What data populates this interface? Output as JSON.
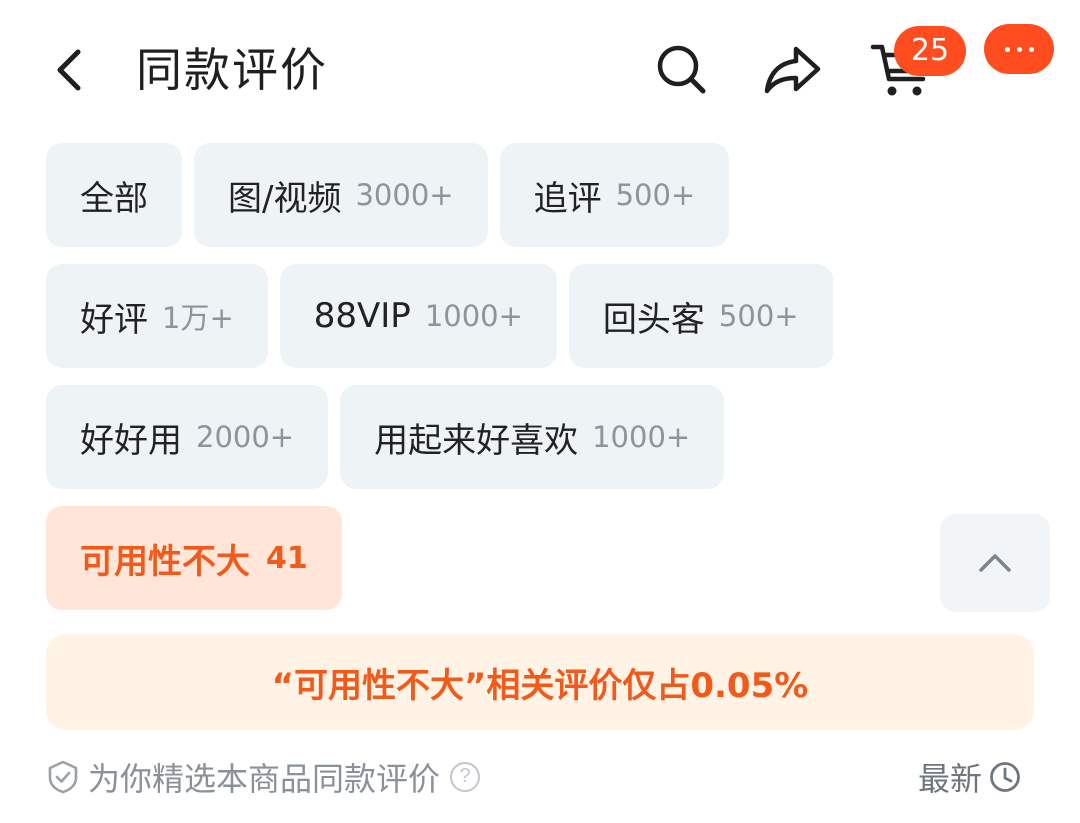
{
  "header": {
    "title": "同款评价",
    "cart_count": "25"
  },
  "filters": {
    "rows": [
      [
        {
          "label": "全部",
          "count": ""
        },
        {
          "label": "图/视频",
          "count": "3000+"
        },
        {
          "label": "追评",
          "count": "500+"
        }
      ],
      [
        {
          "label": "好评",
          "count": "1万+"
        },
        {
          "label": "88VIP",
          "count": "1000+"
        },
        {
          "label": "回头客",
          "count": "500+"
        }
      ],
      [
        {
          "label": "好好用",
          "count": "2000+"
        },
        {
          "label": "用起来好喜欢",
          "count": "1000+"
        }
      ]
    ],
    "active": {
      "label": "可用性不大",
      "count": "41"
    }
  },
  "notice": {
    "text": "“可用性不大”相关评价仅占0.05%"
  },
  "footer": {
    "selection_text": "为你精选本商品同款评价",
    "sort_label": "最新"
  },
  "colors": {
    "accent": "#f25a1b",
    "badge": "#ff4d1f",
    "chip_bg": "#eef3f6",
    "chip_active_bg": "#ffe6d9",
    "notice_bg": "#fff3e6"
  },
  "icons": {
    "back": "chevron-left-icon",
    "search": "search-icon",
    "share": "share-icon",
    "cart": "cart-icon",
    "more": "more-icon",
    "collapse": "chevron-up-icon",
    "verified": "shield-check-icon",
    "help": "help-icon",
    "sort": "clock-icon"
  }
}
